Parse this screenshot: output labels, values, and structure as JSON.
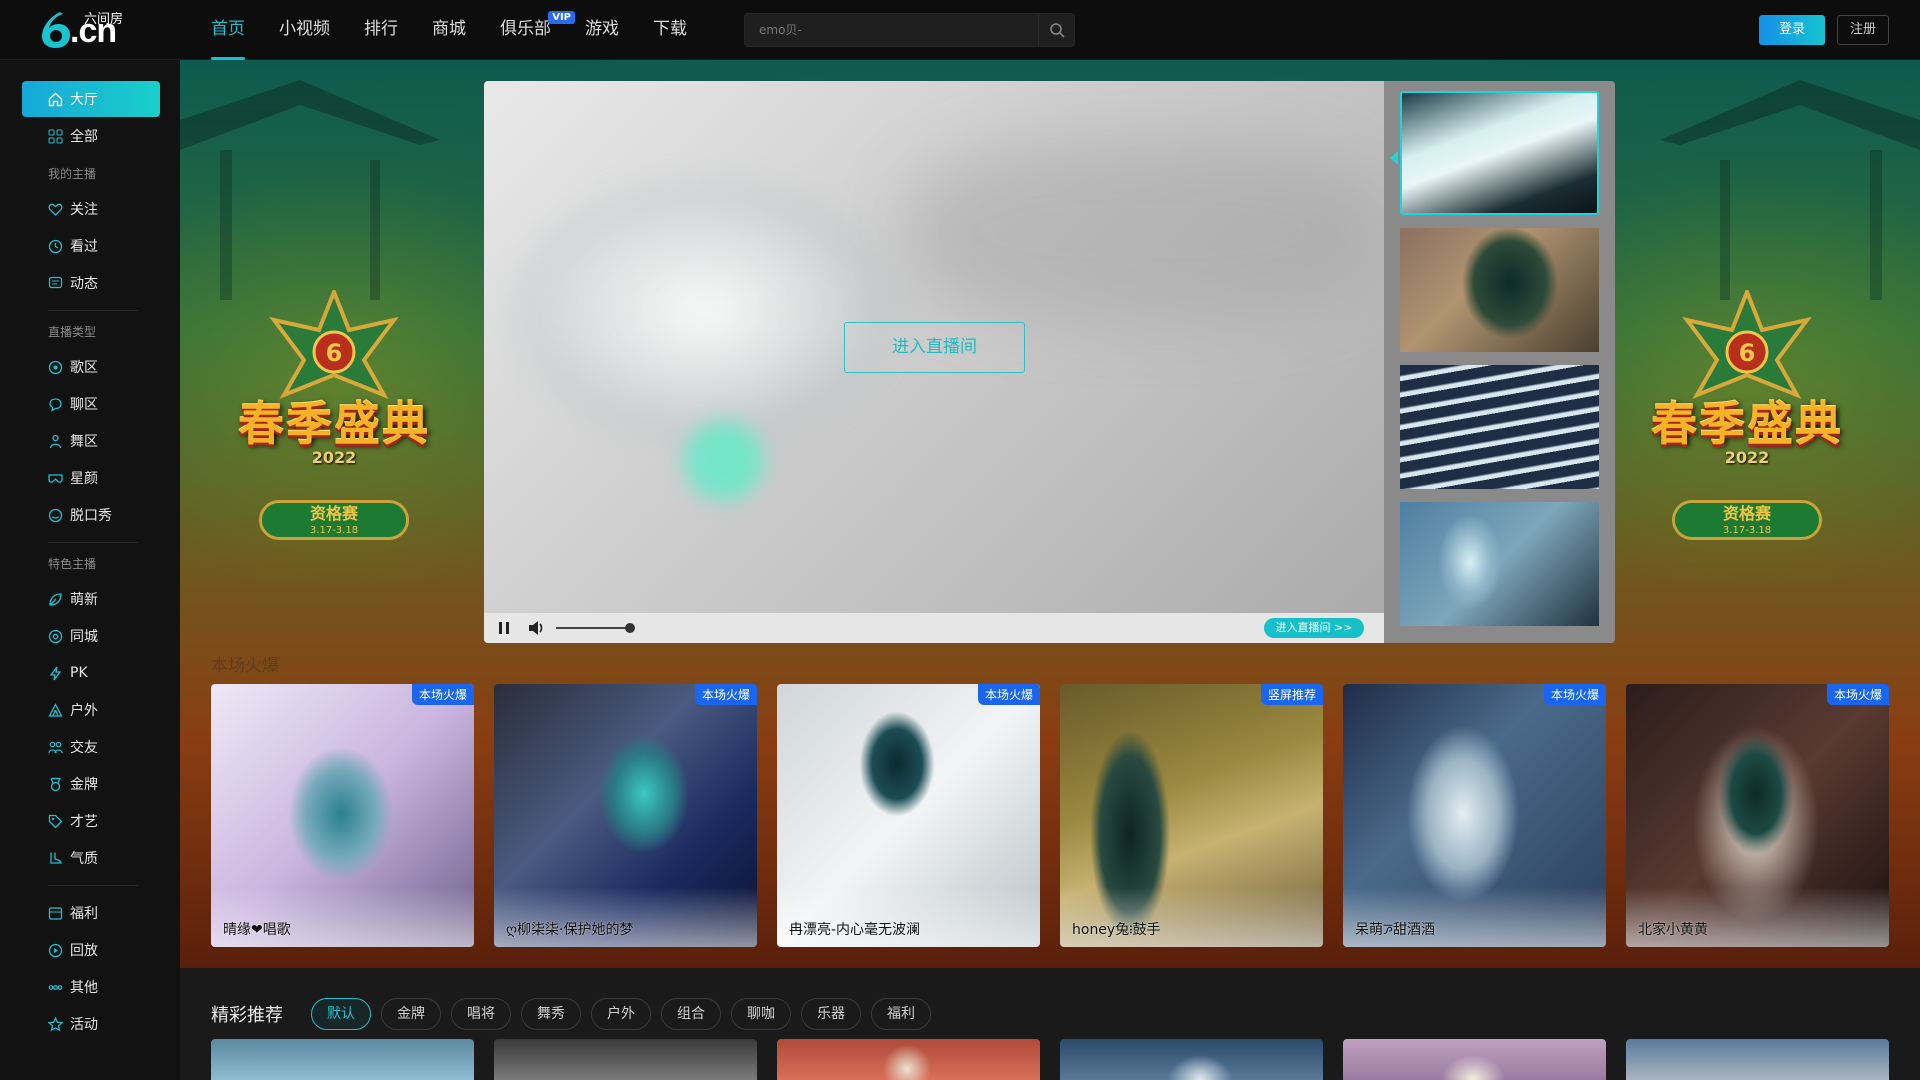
{
  "header": {
    "logo_text": ".cn",
    "logo_caption": "六间房",
    "nav": [
      {
        "label": "首页",
        "active": true
      },
      {
        "label": "小视频"
      },
      {
        "label": "排行"
      },
      {
        "label": "商城"
      },
      {
        "label": "俱乐部",
        "badge": "VIP"
      },
      {
        "label": "游戏"
      },
      {
        "label": "下载"
      }
    ],
    "search_placeholder": "emo贝-",
    "login_label": "登录",
    "register_label": "注册",
    "accent_color": "#17c2cf"
  },
  "sidebar": {
    "top": [
      {
        "label": "大厅",
        "icon": "home-icon",
        "active": true
      },
      {
        "label": "全部",
        "icon": "grid-icon"
      }
    ],
    "group1_title": "我的主播",
    "group1": [
      {
        "label": "关注",
        "icon": "heart-icon"
      },
      {
        "label": "看过",
        "icon": "clock-icon"
      },
      {
        "label": "动态",
        "icon": "chat-icon"
      }
    ],
    "group2_title": "直播类型",
    "group2": [
      {
        "label": "歌区",
        "icon": "music-icon"
      },
      {
        "label": "聊区",
        "icon": "bubble-icon"
      },
      {
        "label": "舞区",
        "icon": "dance-icon"
      },
      {
        "label": "星颜",
        "icon": "mask-icon"
      },
      {
        "label": "脱口秀",
        "icon": "talk-icon"
      }
    ],
    "group3_title": "特色主播",
    "group3": [
      {
        "label": "萌新",
        "icon": "leaf-icon"
      },
      {
        "label": "同城",
        "icon": "location-icon"
      },
      {
        "label": "PK",
        "icon": "lightning-icon"
      },
      {
        "label": "户外",
        "icon": "tent-icon"
      },
      {
        "label": "交友",
        "icon": "people-icon"
      },
      {
        "label": "金牌",
        "icon": "medal-icon"
      },
      {
        "label": "才艺",
        "icon": "tag-icon"
      },
      {
        "label": "气质",
        "icon": "boot-icon"
      }
    ],
    "group4": [
      {
        "label": "福利",
        "icon": "gift-icon"
      },
      {
        "label": "回放",
        "icon": "replay-icon"
      },
      {
        "label": "其他",
        "icon": "more-icon"
      },
      {
        "label": "活动",
        "icon": "star-icon"
      }
    ]
  },
  "hero": {
    "emblem_title": "春季盛典",
    "emblem_year": "2022",
    "emblem_pill_1": "资格赛",
    "emblem_pill_2": "3.17-3.18",
    "player_enter_label": "进入直播间",
    "player_enter_small": "进入直播间 >>"
  },
  "hot_cards": [
    {
      "name": "晴缘❤唱歌",
      "tag": "本场火爆"
    },
    {
      "name": "ღ柳柒柒·保护她的梦",
      "tag": "本场火爆"
    },
    {
      "name": "冉漂亮-内心毫无波澜",
      "tag": "本场火爆"
    },
    {
      "name": "honey兔፧鼓手",
      "tag": "竖屏推荐"
    },
    {
      "name": "呆萌ꯍ甜酒酒",
      "tag": "本场火爆"
    },
    {
      "name": "北家小黄黄",
      "tag": "本场火爆"
    }
  ],
  "recommend": {
    "title": "精彩推荐",
    "tabs": [
      {
        "label": "默认",
        "active": true
      },
      {
        "label": "金牌"
      },
      {
        "label": "唱将"
      },
      {
        "label": "舞秀"
      },
      {
        "label": "户外"
      },
      {
        "label": "组合"
      },
      {
        "label": "聊咖"
      },
      {
        "label": "乐器"
      },
      {
        "label": "福利"
      }
    ]
  }
}
